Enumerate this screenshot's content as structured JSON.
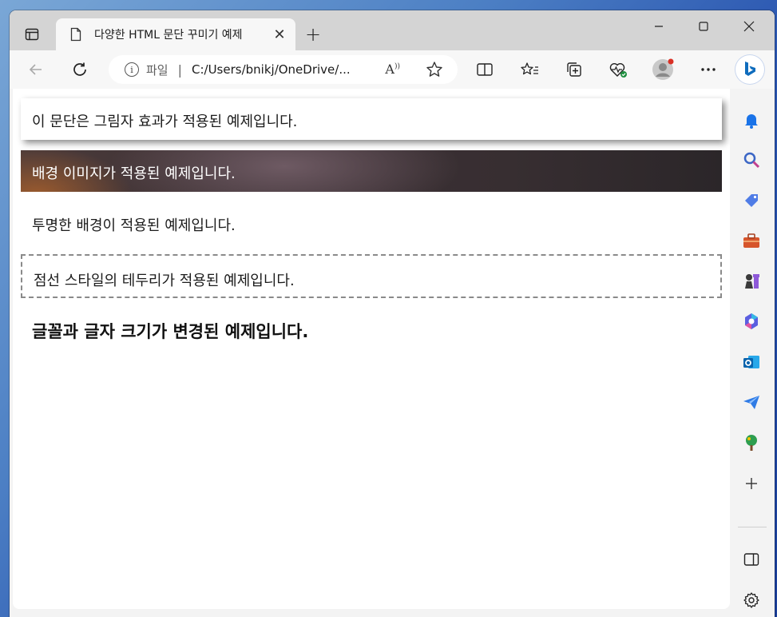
{
  "browser": {
    "tab": {
      "title": "다양한 HTML 문단 꾸미기 예제"
    },
    "address": {
      "scheme": "파일",
      "url": "C:/Users/bnikj/OneDrive/...",
      "read_aloud": "À"
    }
  },
  "content": {
    "paragraphs": [
      "이 문단은 그림자 효과가 적용된 예제입니다.",
      "배경 이미지가 적용된 예제입니다.",
      "투명한 배경이 적용된 예제입니다.",
      "점선 스타일의 테두리가 적용된 예제입니다.",
      "글꼴과 글자 크기가 변경된 예제입니다."
    ]
  },
  "colors": {
    "accent": "#0f6cbd",
    "dashed_border": "#8a8a8a"
  },
  "icons": {
    "sidebar": [
      "bell-icon",
      "search-icon",
      "tag-icon",
      "toolbox-icon",
      "chess-icon",
      "copilot-icon",
      "outlook-icon",
      "send-icon",
      "tree-icon",
      "plus-icon",
      "panel-icon",
      "settings-icon"
    ]
  }
}
